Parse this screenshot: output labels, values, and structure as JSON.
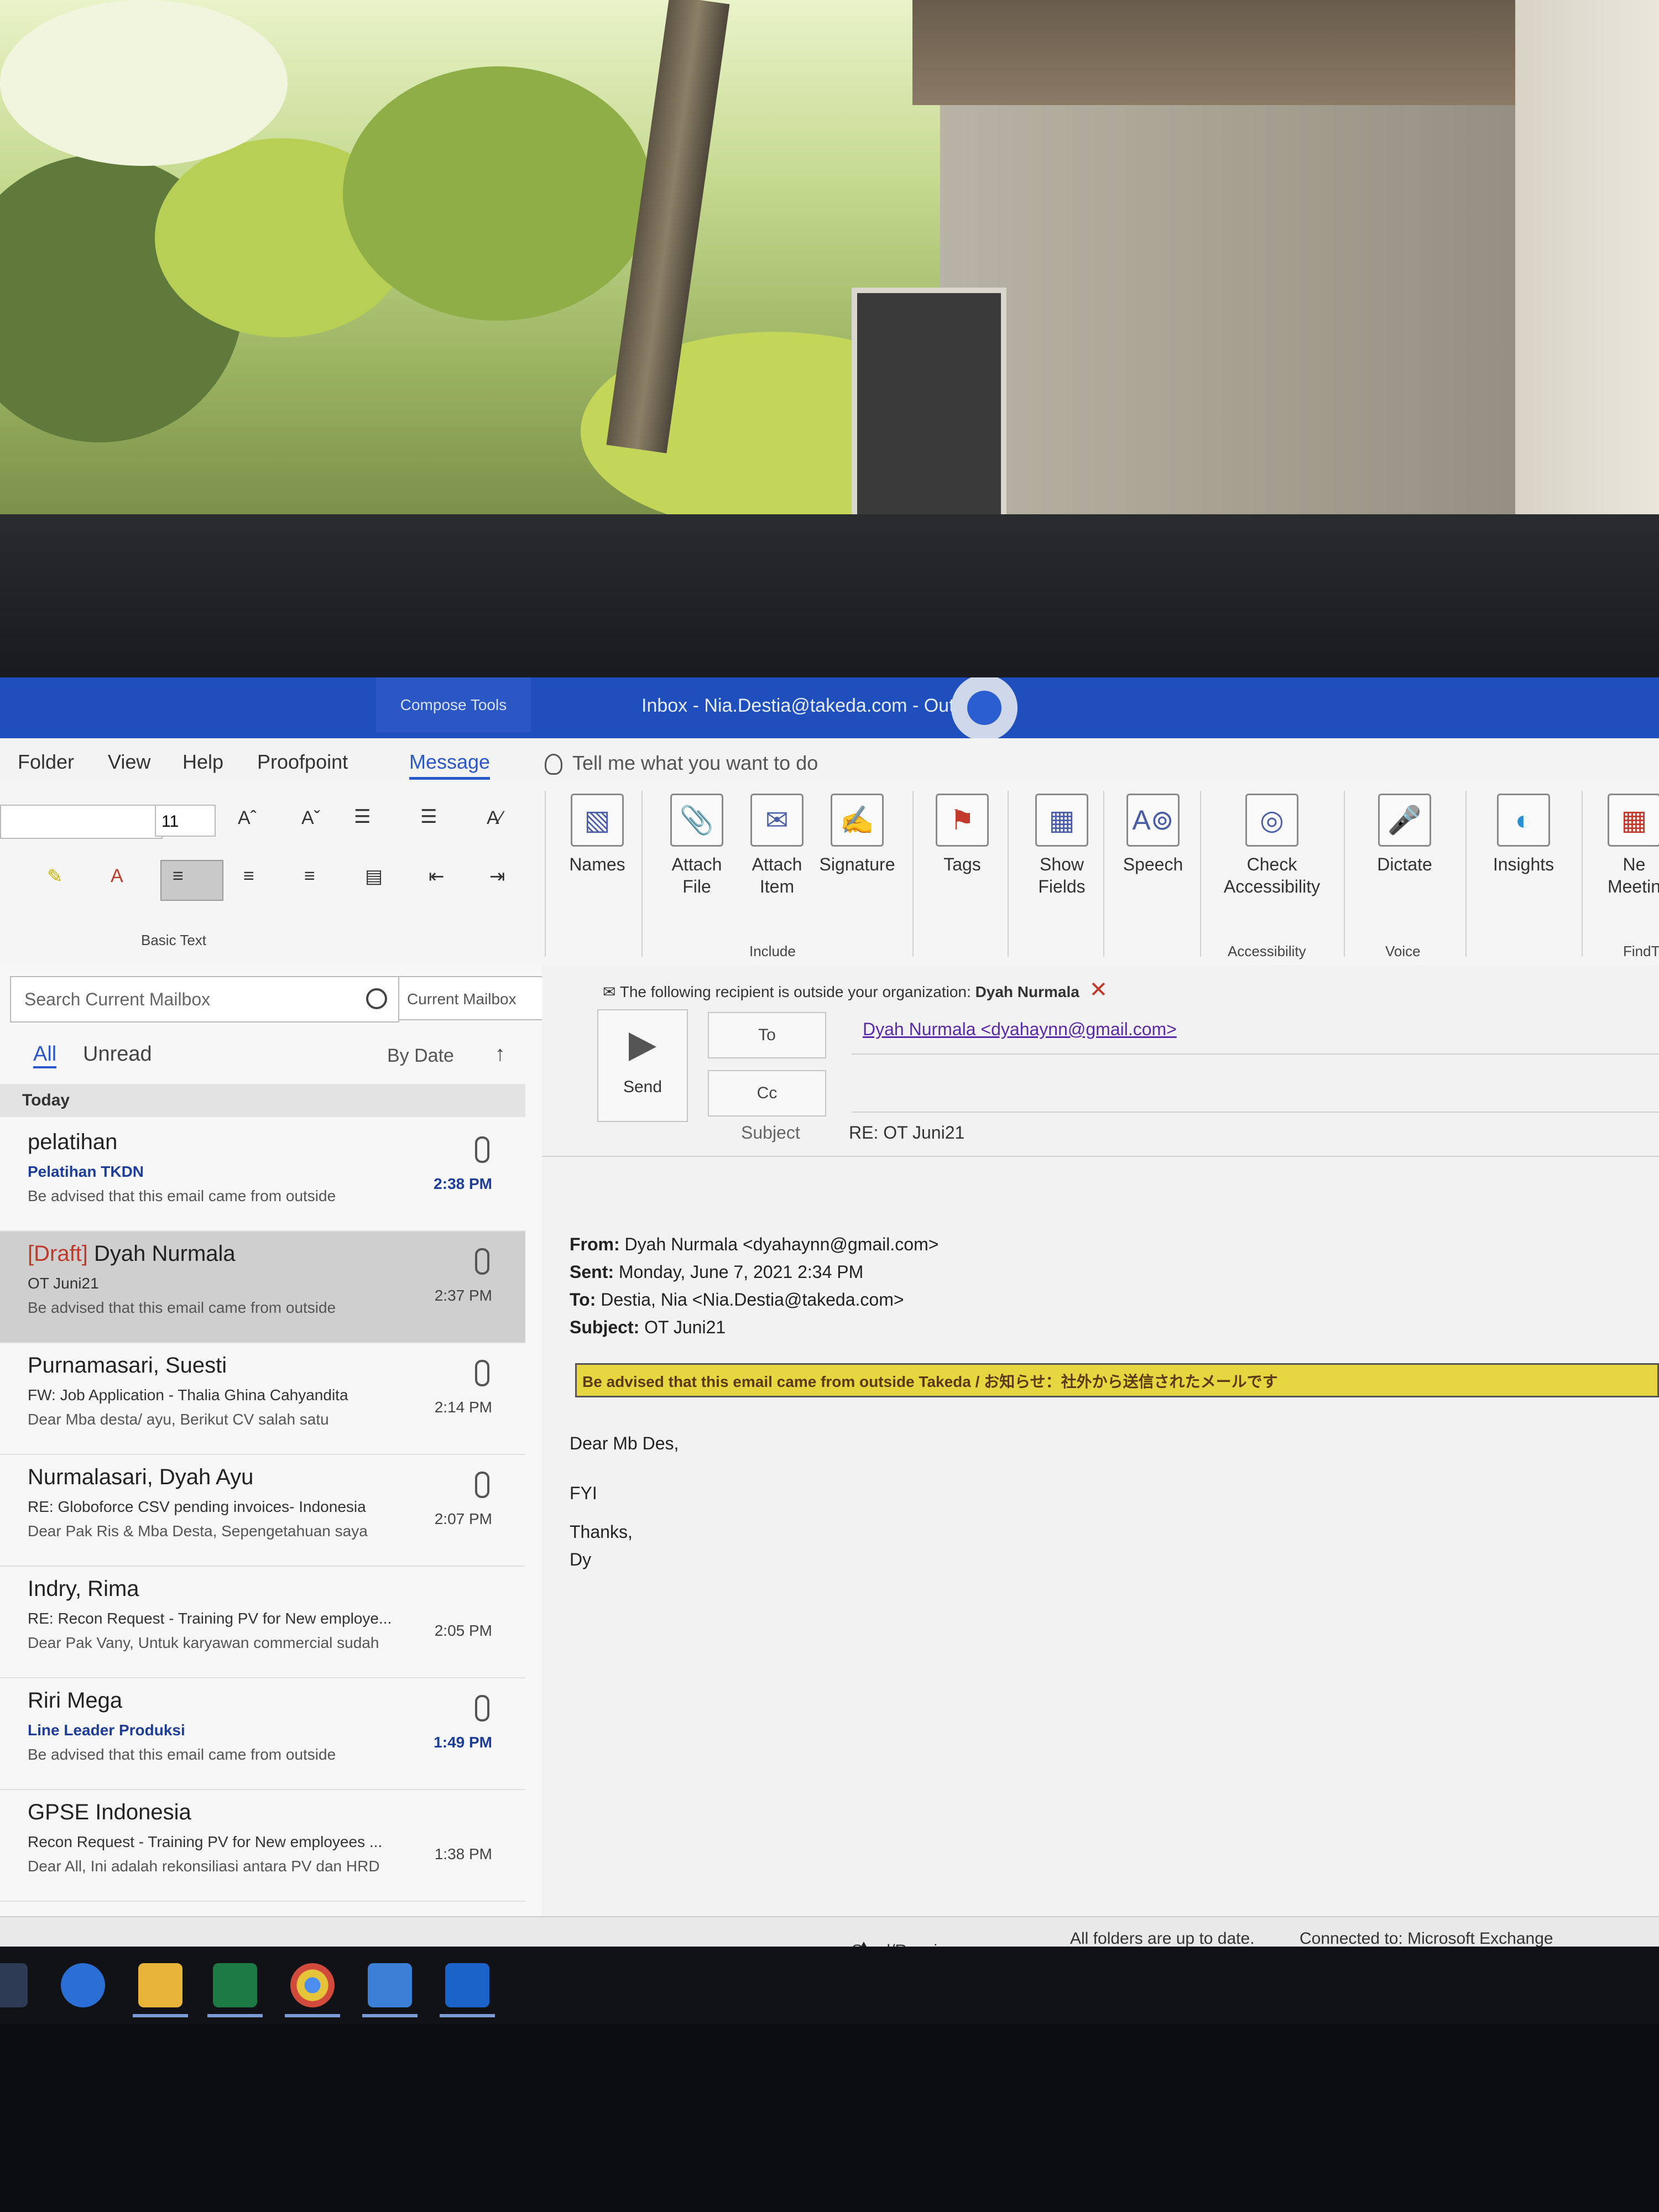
{
  "titlebar": {
    "compose_tools": "Compose Tools",
    "title": "Inbox - Nia.Destia@takeda.com  -  Out"
  },
  "menu": {
    "items": [
      "Folder",
      "View",
      "Help",
      "Proofpoint",
      "Message"
    ],
    "active": "Message",
    "tell_me": "Tell me what you want to do"
  },
  "ribbon": {
    "font_size": "11",
    "basic_text_label": "Basic Text",
    "include_label": "Include",
    "accessibility_label": "Accessibility",
    "voice_label": "Voice",
    "find_label": "FindT",
    "buttons": {
      "names": "Names",
      "attach_file": "Attach File",
      "attach_item": "Attach Item",
      "signature": "Signature",
      "tags": "Tags",
      "show_fields": "Show Fields",
      "speech": "Speech",
      "check_accessibility": "Check Accessibility",
      "dictate": "Dictate",
      "insights": "Insights",
      "new_meeting": "Ne Meetin"
    }
  },
  "mailbox": {
    "search_placeholder": "Search Current Mailbox",
    "scope": "Current Mailbox",
    "filter_all": "All",
    "filter_unread": "Unread",
    "sort": "By Date",
    "group": "Today",
    "messages": [
      {
        "from": "pelatihan",
        "draft": "",
        "subject": "Pelatihan TKDN",
        "preview": "Be advised that this email came from outside",
        "time": "2:38 PM",
        "unread": true,
        "attachment": true
      },
      {
        "from": "Dyah Nurmala",
        "draft": "[Draft]",
        "subject": "OT Juni21",
        "preview": "Be advised that this email came from outside",
        "time": "2:37 PM",
        "unread": false,
        "attachment": true
      },
      {
        "from": "Purnamasari, Suesti",
        "draft": "",
        "subject": "FW: Job Application - Thalia Ghina Cahyandita",
        "preview": "Dear Mba desta/ ayu,  Berikut CV salah satu",
        "time": "2:14 PM",
        "unread": false,
        "attachment": true
      },
      {
        "from": "Nurmalasari, Dyah Ayu",
        "draft": "",
        "subject": "RE: Globoforce CSV pending invoices- Indonesia",
        "preview": "Dear Pak Ris & Mba Desta,  Sepengetahuan saya",
        "time": "2:07 PM",
        "unread": false,
        "attachment": true
      },
      {
        "from": "Indry, Rima",
        "draft": "",
        "subject": "RE: Recon Request - Training PV for New employe...",
        "preview": "Dear Pak Vany,  Untuk karyawan commercial sudah",
        "time": "2:05 PM",
        "unread": false,
        "attachment": false
      },
      {
        "from": "Riri Mega",
        "draft": "",
        "subject": "Line Leader Produksi",
        "preview": "Be advised that this email came from outside",
        "time": "1:49 PM",
        "unread": true,
        "attachment": true
      },
      {
        "from": "GPSE Indonesia",
        "draft": "",
        "subject": "Recon Request - Training PV for New employees ...",
        "preview": "Dear All,  Ini adalah rekonsiliasi antara PV dan HRD",
        "time": "1:38 PM",
        "unread": false,
        "attachment": false
      }
    ]
  },
  "compose": {
    "warning_prefix": "The following recipient is outside your organization:",
    "warning_name": "Dyah Nurmala",
    "send": "Send",
    "to_label": "To",
    "cc_label": "Cc",
    "to_value": "Dyah Nurmala <dyahaynn@gmail.com>",
    "subject_label": "Subject",
    "subject_value": "RE: OT Juni21",
    "quoted": {
      "from_label": "From:",
      "from": "Dyah Nurmala <dyahaynn@gmail.com>",
      "sent_label": "Sent:",
      "sent": "Monday, June 7, 2021 2:34 PM",
      "to_label": "To:",
      "to": "Destia, Nia <Nia.Destia@takeda.com>",
      "subject_label": "Subject:",
      "subject": "OT Juni21"
    },
    "banner": "Be advised that this email came from outside Takeda / お知らせ：社外から送信されたメールです",
    "greeting": "Dear Mb Des,",
    "line1": "FYI",
    "thanks": "Thanks,",
    "sign": "Dy"
  },
  "status": {
    "error": "Send/Receive error",
    "folders": "All folders are up to date.",
    "connected": "Connected to: Microsoft Exchange"
  },
  "colors": {
    "titlebar": "#1f4fbd",
    "accent": "#2b58c9",
    "banner": "#e8d640"
  }
}
